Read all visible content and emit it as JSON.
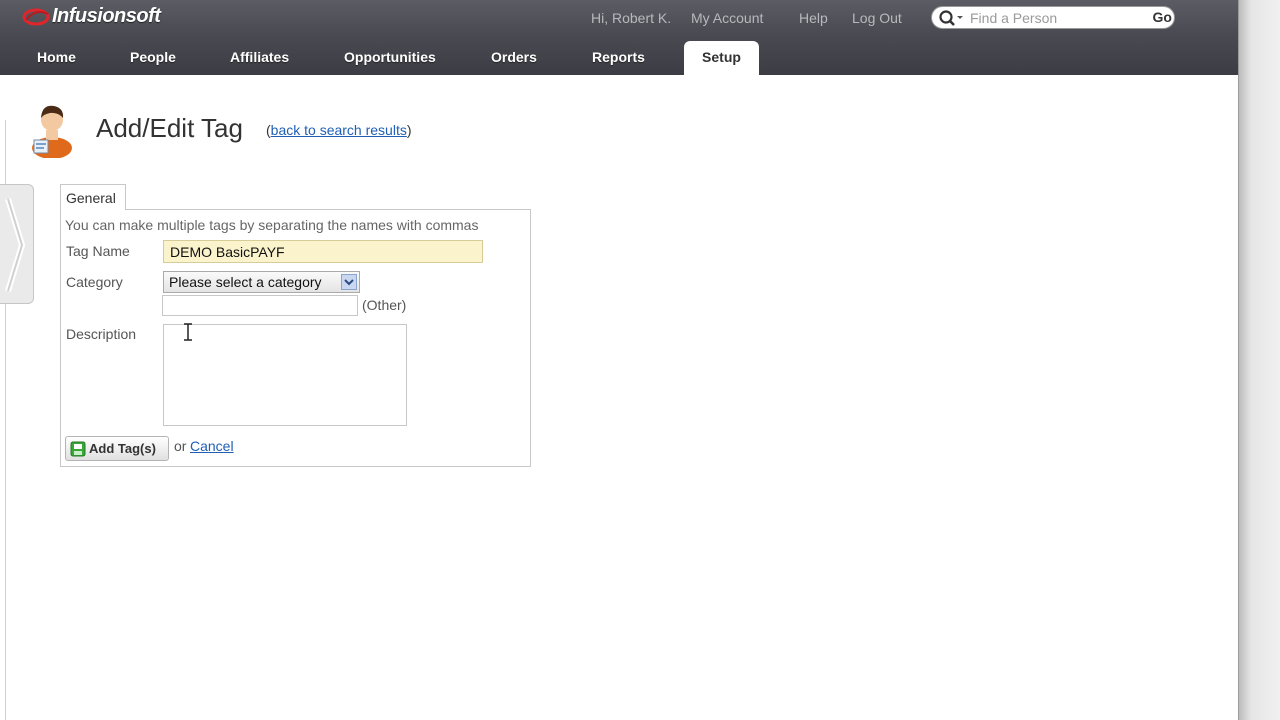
{
  "app": {
    "name": "Infusionsoft"
  },
  "header": {
    "greeting": "Hi, Robert K.",
    "my_account": "My Account",
    "help": "Help",
    "log_out": "Log Out",
    "search": {
      "placeholder": "Find a Person",
      "go_label": "Go"
    }
  },
  "nav": {
    "tabs": [
      {
        "label": "Home"
      },
      {
        "label": "People"
      },
      {
        "label": "Affiliates"
      },
      {
        "label": "Opportunities"
      },
      {
        "label": "Orders"
      },
      {
        "label": "Reports"
      },
      {
        "label": "Setup",
        "active": true
      }
    ]
  },
  "page": {
    "title": "Add/Edit Tag",
    "back_open": "(",
    "back_link": "back to search results",
    "back_close": ")"
  },
  "form": {
    "tab_label": "General",
    "hint": "You can make multiple tags by separating the names with commas",
    "tag_name_label": "Tag Name",
    "tag_name_value": "DEMO BasicPAYF",
    "category_label": "Category",
    "category_selected": "Please select a category",
    "other_label": "(Other)",
    "description_label": "Description",
    "add_button": "Add Tag(s)",
    "or_text": "or",
    "cancel_link": "Cancel"
  },
  "colors": {
    "header_bg": "#4a4a52",
    "link": "#1f5fb4",
    "tag_input_bg": "#fbf3cc"
  }
}
